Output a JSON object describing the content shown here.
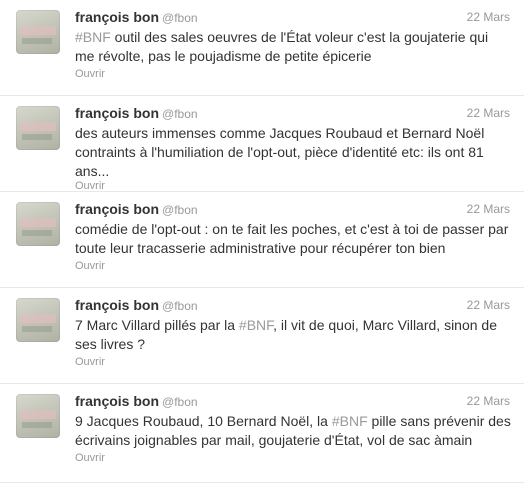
{
  "tweets": [
    {
      "fullname": "françois bon",
      "username": "@fbon",
      "date": "22 Mars",
      "hashtag": "#BNF",
      "text_before": "",
      "text_after": " outil des sales oeuvres de l'État voleur c'est la goujaterie qui me révolte, pas le poujadisme de petite épicerie",
      "open_label": "Ouvrir"
    },
    {
      "fullname": "françois bon",
      "username": "@fbon",
      "date": "22 Mars",
      "text": "des auteurs immenses comme Jacques Roubaud et Bernard Noël contraints à l'humiliation de l'opt-out, pièce d'identité etc: ils ont 81 ans...",
      "open_label": "Ouvrir"
    },
    {
      "fullname": "françois bon",
      "username": "@fbon",
      "date": "22 Mars",
      "text": "comédie de l'opt-out : on te fait les poches, et c'est à toi de passer par toute leur tracasserie administrative pour récupérer ton bien",
      "open_label": "Ouvrir"
    },
    {
      "fullname": "françois bon",
      "username": "@fbon",
      "date": "22 Mars",
      "hashtag": "#BNF",
      "text_before": "7 Marc Villard pillés par la ",
      "text_after": ", il vit de quoi, Marc Villard, sinon de ses livres ?",
      "open_label": "Ouvrir"
    },
    {
      "fullname": "françois bon",
      "username": "@fbon",
      "date": "22 Mars",
      "hashtag": "#BNF",
      "text_before": "9 Jacques Roubaud, 10 Bernard Noël, la ",
      "text_after": " pille sans prévenir des écrivains joignables par mail, goujaterie d'État, vol de sac àmain",
      "open_label": "Ouvrir"
    }
  ],
  "colors": {
    "text": "#333333",
    "muted": "#999999",
    "divider": "#e8e8e8"
  }
}
